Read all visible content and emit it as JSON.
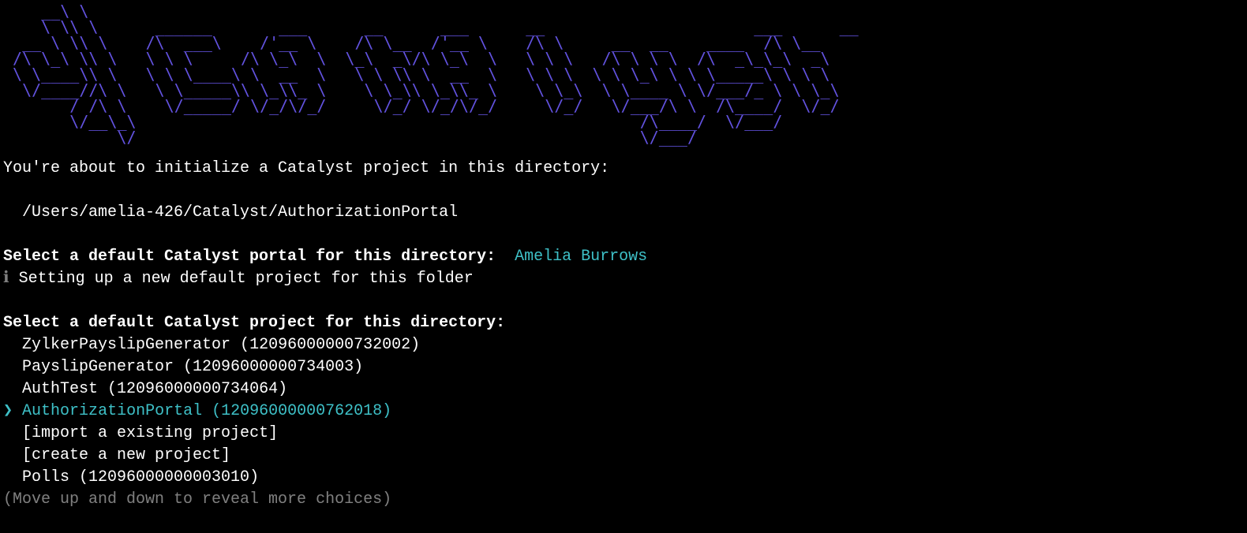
{
  "ascii_logo": "    __\\ \\    \n    \\ \\\\ \\      ______       ___      __      ___      __                      ___      __     \n  __ \\ \\\\ \\    /\\  ___\\    /'__ \\    /\\ \\__  /'__ \\    /\\ \\     __  __    ____  /\\ \\__   \n /\\ \\_\\ \\\\ \\   \\ \\ \\     /\\ \\_\\  \\  \\_\\  _\\/\\ \\_\\  \\   \\ \\ \\   /\\ \\ \\ \\  /\\  _\\_\\_\\  _\\  \n \\ \\____\\\\ \\   \\ \\ \\____\\ \\  __  \\   \\ \\ \\\\ \\  __  \\   \\ \\ \\  \\ \\ \\_\\ \\ \\ \\_____\\ \\ \\ \\ \n  \\/____//\\ \\   \\ \\_____\\\\ \\_\\\\_ \\    \\ \\_\\\\ \\_\\\\_ \\    \\ \\_\\  \\ \\____ \\ \\/___/_ \\ \\ \\_\\ \n       / /\\ \\    \\/_____/ \\/_/\\/_/     \\/_/ \\/_/\\/_/     \\/_/   \\/___/\\ \\  /\\____/  \\/_/ \n       \\/__\\_\\                                                     /\\____/  \\/___/           \n            \\/                                                     \\/___/                    ",
  "intro_text": "You're about to initialize a Catalyst project in this directory:",
  "directory_path": "  /Users/amelia-426/Catalyst/AuthorizationPortal",
  "portal_prompt": "Select a default Catalyst portal for this directory:",
  "portal_selected": "  Amelia Burrows",
  "info_symbol": "ℹ",
  "info_text": " Setting up a new default project for this folder",
  "project_prompt": "Select a default Catalyst project for this directory:",
  "pointer_symbol": "❯",
  "projects": [
    {
      "label": "ZylkerPayslipGenerator (12096000000732002)",
      "selected": false
    },
    {
      "label": "PayslipGenerator (12096000000734003)",
      "selected": false
    },
    {
      "label": "AuthTest (12096000000734064)",
      "selected": false
    },
    {
      "label": "AuthorizationPortal (12096000000762018)",
      "selected": true
    },
    {
      "label": "[import a existing project]",
      "selected": false
    },
    {
      "label": "[create a new project]",
      "selected": false
    },
    {
      "label": "Polls (12096000000003010)",
      "selected": false
    }
  ],
  "hint_text": "(Move up and down to reveal more choices)"
}
